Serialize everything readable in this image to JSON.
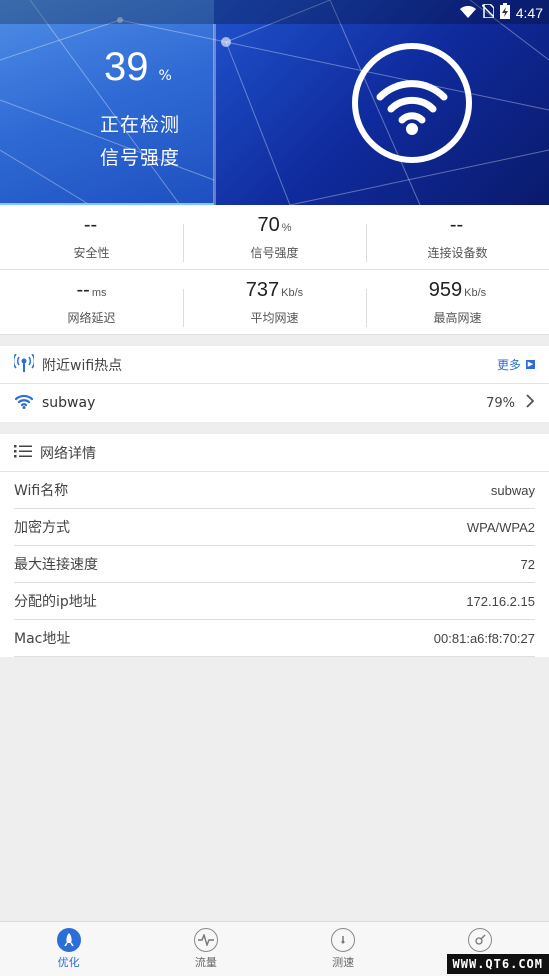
{
  "status_bar": {
    "time": "4:47"
  },
  "hero": {
    "percent_value": "39",
    "percent_unit": "%",
    "line1": "正在检测",
    "line2": "信号强度",
    "progress": 0.39
  },
  "stats": {
    "row1": [
      {
        "value": "--",
        "unit": "",
        "label": "安全性"
      },
      {
        "value": "70",
        "unit": "%",
        "label": "信号强度"
      },
      {
        "value": "--",
        "unit": "",
        "label": "连接设备数"
      }
    ],
    "row2": [
      {
        "value": "--",
        "unit": "ms",
        "label": "网络延迟"
      },
      {
        "value": "737",
        "unit": "Kb/s",
        "label": "平均网速"
      },
      {
        "value": "959",
        "unit": "Kb/s",
        "label": "最高网速"
      }
    ]
  },
  "nearby": {
    "title": "附近wifi热点",
    "more_label": "更多",
    "hotspot": {
      "name": "subway",
      "percent": "79%"
    }
  },
  "details": {
    "title": "网络详情",
    "rows": [
      {
        "key": "Wifi名称",
        "value": "subway"
      },
      {
        "key": "加密方式",
        "value": "WPA/WPA2"
      },
      {
        "key": "最大连接速度",
        "value": "72"
      },
      {
        "key": "分配的ip地址",
        "value": "172.16.2.15"
      },
      {
        "key": "Mac地址",
        "value": "00:81:a6:f8:70:27"
      }
    ]
  },
  "tabs": [
    {
      "label": "优化",
      "icon": "rocket-icon",
      "active": true
    },
    {
      "label": "流量",
      "icon": "pulse-icon",
      "active": false
    },
    {
      "label": "测速",
      "icon": "speedometer-icon",
      "active": false
    },
    {
      "label": "",
      "icon": "satellite-dish-icon",
      "active": false
    }
  ],
  "watermark": "WWW.QT6.COM",
  "colors": {
    "accent": "#2a6fd9",
    "hero_dark": "#0f2a9c"
  }
}
